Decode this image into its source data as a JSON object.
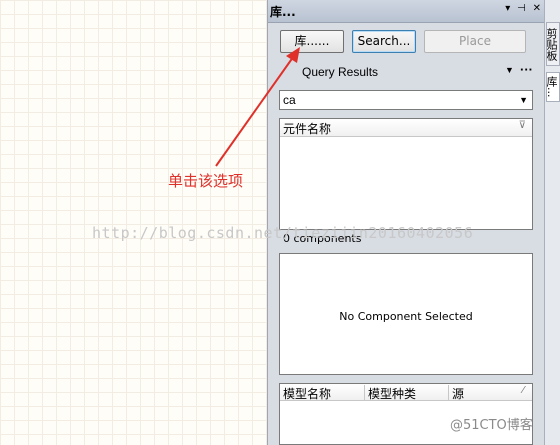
{
  "panel": {
    "title": "库...",
    "titlebar_icons": [
      "▾",
      "⊣",
      "✕"
    ],
    "buttons": {
      "library": "库......",
      "search": "Search...",
      "place": "Place"
    },
    "query_results": "Query Results",
    "dropdown_arrow": "▼",
    "more_icon": "···",
    "search_value": "ca",
    "components_list": {
      "header": "元件名称",
      "filter_icon": "⊽"
    },
    "component_count": "0 components",
    "preview_message": "No Component Selected",
    "models_table": {
      "columns": [
        "模型名称",
        "模型种类",
        "源"
      ],
      "filter_icon": "⁄"
    }
  },
  "side_tabs": [
    "剪贴板",
    "库..."
  ],
  "annotation": {
    "text": "单击该选项",
    "color": "#e0302a"
  },
  "watermark": "http://blog.csdn.net/tiezijin20160402056",
  "corner_mark": "@51CTO博客"
}
